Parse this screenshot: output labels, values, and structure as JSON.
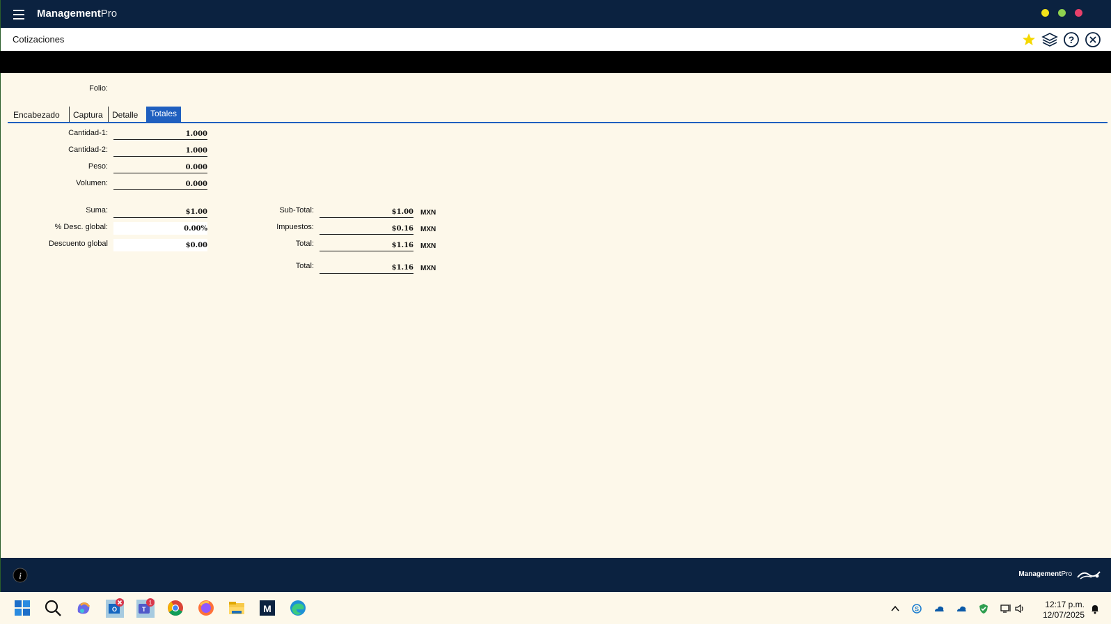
{
  "app": {
    "name": "Management",
    "name_suffix": "Pro"
  },
  "window_controls": {
    "minimize_color": "#f2e21a",
    "maximize_color": "#8fd14f",
    "close_color": "#e8406a"
  },
  "header": {
    "title": "Cotizaciones",
    "icons": [
      "star-icon",
      "layers-icon",
      "help-icon",
      "close-icon"
    ]
  },
  "form": {
    "folio_label": "Folio:",
    "tabs": [
      "Encabezado",
      "Captura",
      "Detalle",
      "Totales"
    ],
    "active_tab": "Totales",
    "quantities": [
      {
        "label": "Cantidad-1:",
        "value": "1.000"
      },
      {
        "label": "Cantidad-2:",
        "value": "1.000"
      },
      {
        "label": "Peso:",
        "value": "0.000"
      },
      {
        "label": "Volumen:",
        "value": "0.000"
      }
    ],
    "sums": [
      {
        "label": "Suma:",
        "value": "$1.00"
      },
      {
        "label": "% Desc. global:",
        "value": "0.00%"
      },
      {
        "label": "Descuento global",
        "value": "$0.00"
      }
    ],
    "totals": [
      {
        "label": "Sub-Total:",
        "value": "$1.00",
        "currency": "MXN"
      },
      {
        "label": "Impuestos:",
        "value": "$0.16",
        "currency": "MXN"
      },
      {
        "label": "Total:",
        "value": "$1.16",
        "currency": "MXN"
      },
      {
        "label": "Total:",
        "value": "$1.16",
        "currency": "MXN"
      }
    ]
  },
  "footer": {
    "brand": "Management",
    "brand_suffix": "Pro"
  },
  "taskbar": {
    "apps": [
      "windows-start-icon",
      "search-icon",
      "copilot-icon",
      "outlook-icon",
      "teams-icon",
      "chrome-icon",
      "firefox-icon",
      "file-explorer-icon",
      "management-pro-icon",
      "edge-icon"
    ],
    "teams_badge": "1",
    "time": "12:17 p.m.",
    "date": "12/07/2025"
  }
}
